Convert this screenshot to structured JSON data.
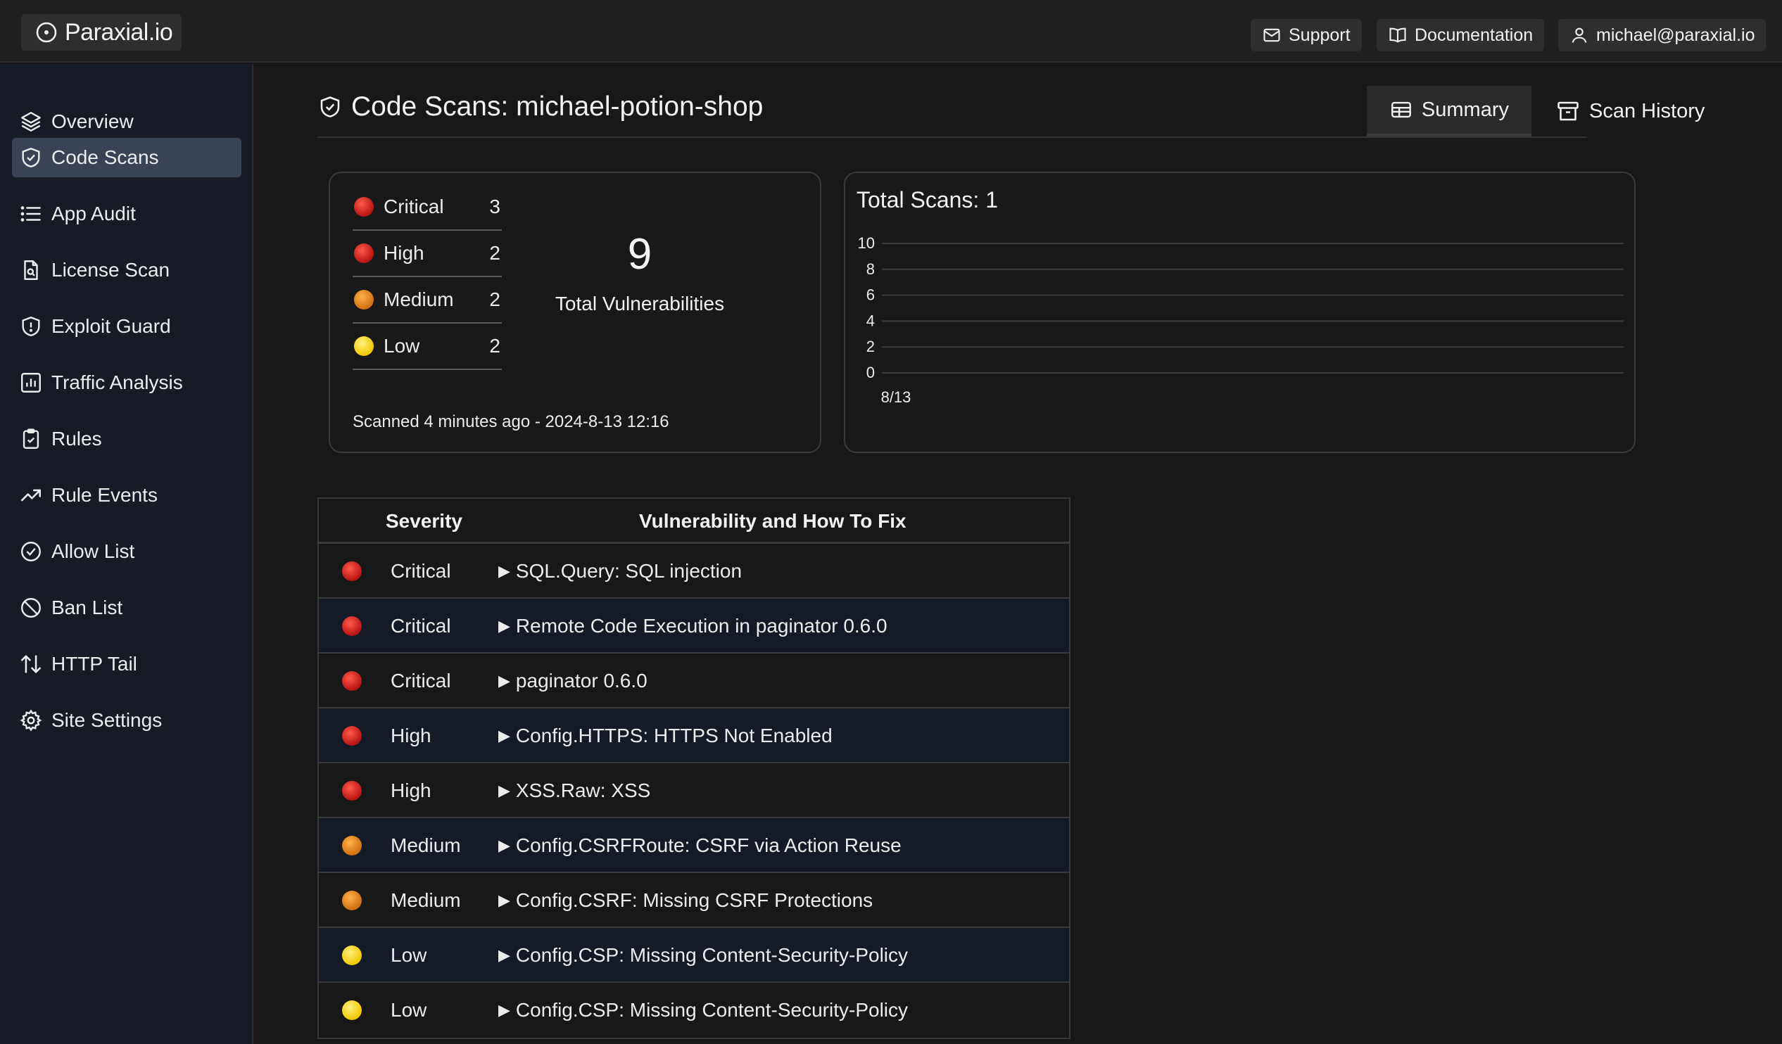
{
  "app": {
    "logo_text": "Paraxial.io"
  },
  "topbar": {
    "support": "Support",
    "documentation": "Documentation",
    "user_email": "michael@paraxial.io"
  },
  "sidebar": {
    "items": [
      {
        "label": "Overview",
        "icon": "layers-icon"
      },
      {
        "label": "Code Scans",
        "icon": "shield-check-icon",
        "active": true
      },
      {
        "label": "App Audit",
        "icon": "list-icon"
      },
      {
        "label": "License Scan",
        "icon": "file-search-icon"
      },
      {
        "label": "Exploit Guard",
        "icon": "shield-alert-icon"
      },
      {
        "label": "Traffic Analysis",
        "icon": "bar-chart-icon"
      },
      {
        "label": "Rules",
        "icon": "clipboard-check-icon"
      },
      {
        "label": "Rule Events",
        "icon": "trending-up-icon"
      },
      {
        "label": "Allow List",
        "icon": "check-circle-icon"
      },
      {
        "label": "Ban List",
        "icon": "ban-icon"
      },
      {
        "label": "HTTP Tail",
        "icon": "arrows-up-down-icon"
      },
      {
        "label": "Site Settings",
        "icon": "gear-icon"
      }
    ]
  },
  "page": {
    "title": "Code Scans: michael-potion-shop",
    "tabs": {
      "summary": "Summary",
      "scan_history": "Scan History"
    }
  },
  "summary": {
    "severities": [
      {
        "label": "Critical",
        "count": "3",
        "color": "red"
      },
      {
        "label": "High",
        "count": "2",
        "color": "red"
      },
      {
        "label": "Medium",
        "count": "2",
        "color": "orange"
      },
      {
        "label": "Low",
        "count": "2",
        "color": "yellow"
      }
    ],
    "total": "9",
    "total_label": "Total Vulnerabilities",
    "scanned": "Scanned 4 minutes ago - 2024-8-13 12:16"
  },
  "chart_data": {
    "type": "bar",
    "title": "Total Scans: 1",
    "categories": [
      "8/13"
    ],
    "y_ticks": [
      "10",
      "8",
      "6",
      "4",
      "2",
      "0"
    ],
    "ylim": [
      0,
      10
    ],
    "grid": true
  },
  "table": {
    "headers": {
      "severity": "Severity",
      "vulnerability": "Vulnerability and How To Fix"
    },
    "rows": [
      {
        "severity": "Critical",
        "vuln": "SQL.Query: SQL injection",
        "color": "red"
      },
      {
        "severity": "Critical",
        "vuln": "Remote Code Execution in paginator 0.6.0",
        "color": "red"
      },
      {
        "severity": "Critical",
        "vuln": "paginator 0.6.0",
        "color": "red"
      },
      {
        "severity": "High",
        "vuln": "Config.HTTPS: HTTPS Not Enabled",
        "color": "red"
      },
      {
        "severity": "High",
        "vuln": "XSS.Raw: XSS",
        "color": "red"
      },
      {
        "severity": "Medium",
        "vuln": "Config.CSRFRoute: CSRF via Action Reuse",
        "color": "orange"
      },
      {
        "severity": "Medium",
        "vuln": "Config.CSRF: Missing CSRF Protections",
        "color": "orange"
      },
      {
        "severity": "Low",
        "vuln": "Config.CSP: Missing Content-Security-Policy",
        "color": "yellow"
      },
      {
        "severity": "Low",
        "vuln": "Config.CSP: Missing Content-Security-Policy",
        "color": "yellow"
      }
    ]
  },
  "colors": {
    "red": "#d42020",
    "orange": "#e88a20",
    "yellow": "#f5d20a",
    "active_nav": "#3a4354"
  }
}
